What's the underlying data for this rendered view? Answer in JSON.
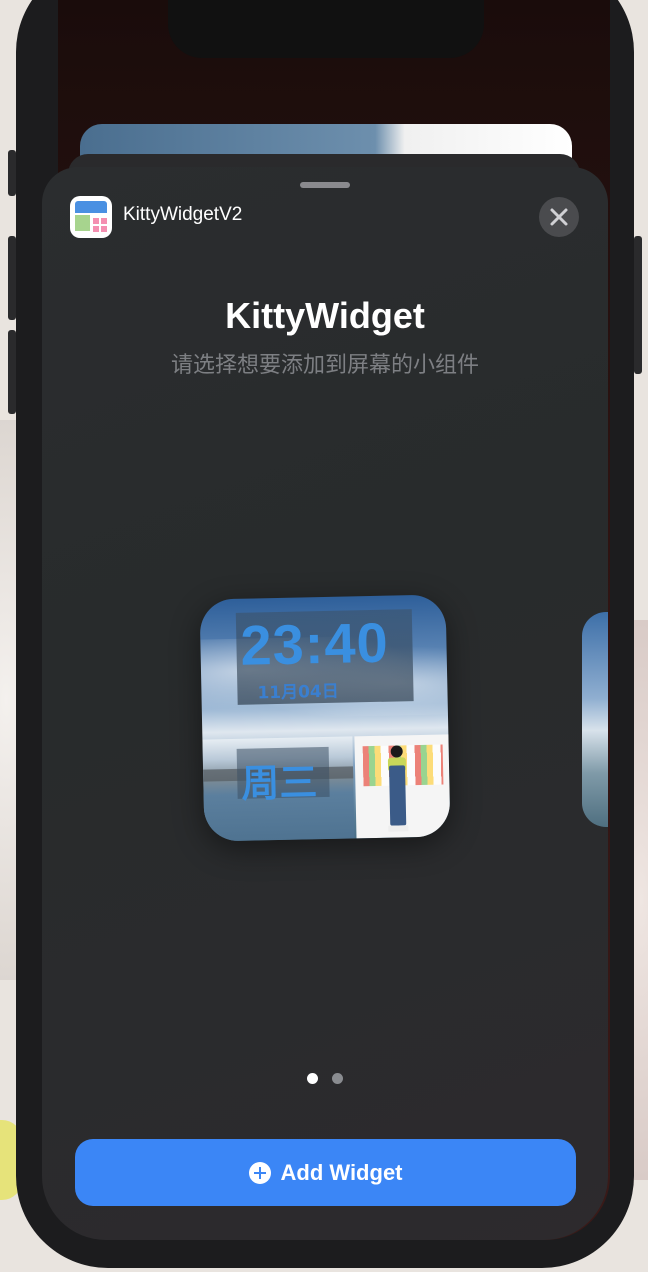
{
  "sheet": {
    "app_name": "KittyWidgetV2",
    "title": "KittyWidget",
    "subtitle": "请选择想要添加到屏幕的小组件",
    "close_icon": "close-icon",
    "app_icon": "kittywidget-app-icon"
  },
  "widget_preview": {
    "time": "23:40",
    "date": "11月04日",
    "weekday": "周三"
  },
  "pager": {
    "page_count": 2,
    "current_page": 1
  },
  "add_button": {
    "label": "Add Widget",
    "icon": "plus-circle-icon"
  },
  "colors": {
    "accent": "#3b86f6",
    "sheet_background": "#2a2b2d",
    "widget_time_color": "#3a8fe0"
  }
}
